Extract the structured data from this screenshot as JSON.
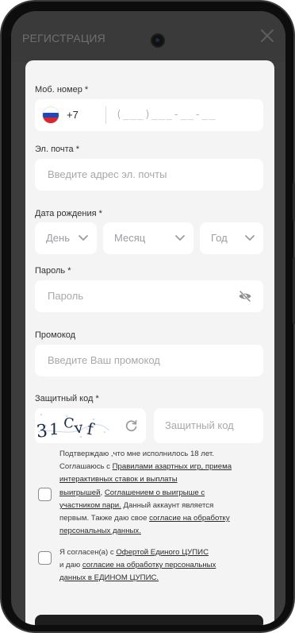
{
  "topbar": {
    "title": "РЕГИСТРАЦИЯ",
    "close_icon": "close-icon"
  },
  "phone_field": {
    "label": "Моб. номер *",
    "flag": "ru-flag-icon",
    "country_code": "+7",
    "mask": "(___)___-__-__"
  },
  "email_field": {
    "label": "Эл. почта *",
    "placeholder": "Введите адрес эл. почты"
  },
  "birthdate": {
    "label": "Дата рождения *",
    "day": "День",
    "month": "Месяц",
    "year": "Год"
  },
  "password_field": {
    "label": "Пароль *",
    "placeholder": "Пароль",
    "toggle_icon": "eye-off-icon"
  },
  "promo_field": {
    "label": "Промокод",
    "placeholder": "Введите Ваш промокод"
  },
  "captcha": {
    "label": "Защитный код *",
    "image_text": "31Cvf",
    "placeholder": "Защитный код",
    "refresh_icon": "refresh-icon"
  },
  "consent1": {
    "line1": "Подтверждаю ,что мне исполнилось 18 лет.",
    "line2a": "Соглашаюсь с ",
    "link1": "Правилами азартных игр, приема",
    "link1b": "интерактивных ставок и выплаты",
    "link1c": "выигрышей",
    "sep": ", ",
    "link2": "Соглашением о выигрыше с",
    "link2b": "участником пари.",
    "line_mid": " Данный аккаунт является",
    "line_mid2": "первым. Также даю свое ",
    "link3": "согласие на обработку",
    "link3b": "персональных данных."
  },
  "consent2": {
    "line1a": "Я согласен(а) с ",
    "link1": "Офертой Единого ЦУПИС",
    "line2a": "и даю ",
    "link2": "согласие на обработку персональных",
    "link2b": "данных в ЕДИНОМ ЦУПИС."
  },
  "colors": {
    "panel": "#f4f4f5",
    "field": "#ffffff",
    "submit": "#1e1e1e"
  }
}
